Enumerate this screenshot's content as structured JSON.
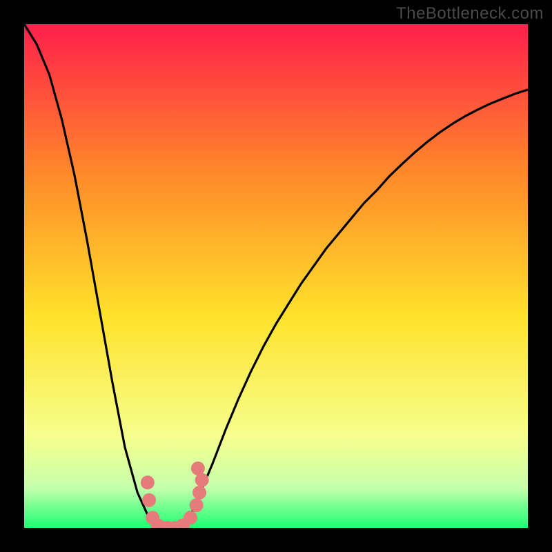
{
  "watermark": "TheBottleneck.com",
  "colors": {
    "bg": "#000000",
    "grad_top": "#ff1f4b",
    "grad_mid_upper": "#ff8a2a",
    "grad_mid": "#ffe22b",
    "grad_lower": "#f6ff8f",
    "grad_band_light": "#c6ffab",
    "grad_bottom": "#1cff72",
    "curve": "#000000",
    "markers": "#e57b7b"
  },
  "chart_data": {
    "type": "line",
    "title": "",
    "xlabel": "",
    "ylabel": "",
    "xlim": [
      0,
      1
    ],
    "ylim": [
      0,
      1
    ],
    "x": [
      0.0,
      0.025,
      0.05,
      0.075,
      0.1,
      0.125,
      0.15,
      0.175,
      0.2,
      0.225,
      0.25,
      0.26,
      0.27,
      0.28,
      0.29,
      0.3,
      0.31,
      0.32,
      0.33,
      0.34,
      0.35,
      0.375,
      0.4,
      0.425,
      0.45,
      0.475,
      0.5,
      0.525,
      0.55,
      0.575,
      0.6,
      0.625,
      0.65,
      0.675,
      0.7,
      0.725,
      0.75,
      0.775,
      0.8,
      0.825,
      0.85,
      0.875,
      0.9,
      0.925,
      0.95,
      0.975,
      1.0
    ],
    "values": [
      1.0,
      0.96,
      0.9,
      0.81,
      0.7,
      0.57,
      0.43,
      0.29,
      0.16,
      0.07,
      0.015,
      0.008,
      0.003,
      0.0,
      0.0,
      0.0,
      0.002,
      0.01,
      0.025,
      0.045,
      0.07,
      0.13,
      0.195,
      0.255,
      0.31,
      0.36,
      0.405,
      0.445,
      0.485,
      0.52,
      0.555,
      0.585,
      0.615,
      0.645,
      0.67,
      0.698,
      0.722,
      0.745,
      0.766,
      0.785,
      0.802,
      0.817,
      0.83,
      0.842,
      0.852,
      0.862,
      0.87
    ],
    "markers": {
      "x": [
        0.245,
        0.248,
        0.255,
        0.265,
        0.275,
        0.285,
        0.3,
        0.315,
        0.33,
        0.342,
        0.348,
        0.353,
        0.345
      ],
      "y": [
        0.09,
        0.055,
        0.02,
        0.005,
        0.0,
        0.0,
        0.0,
        0.005,
        0.02,
        0.045,
        0.07,
        0.095,
        0.118
      ]
    }
  }
}
